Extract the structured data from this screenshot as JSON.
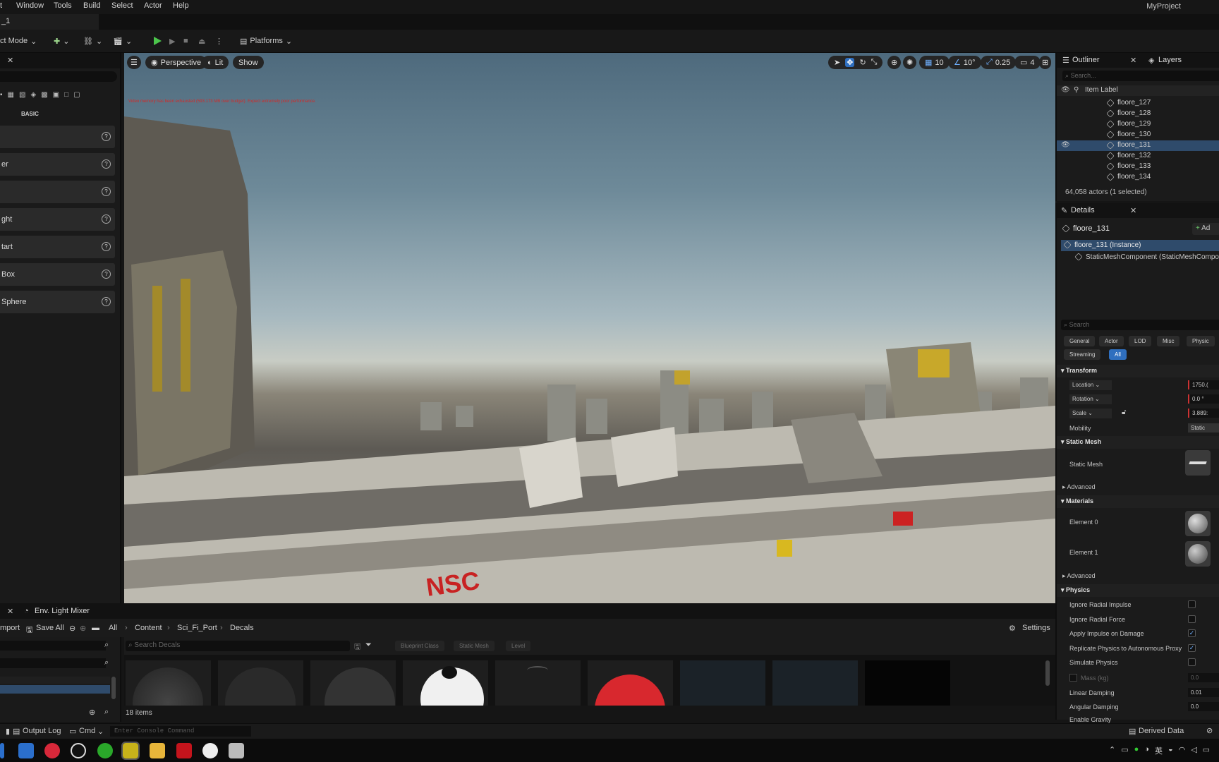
{
  "menu": [
    "Window",
    "Tools",
    "Build",
    "Select",
    "Actor",
    "Help"
  ],
  "project_name": "MyProject",
  "map_tab": "_1",
  "toolbar": {
    "mode": "ct Mode",
    "platforms": "Platforms"
  },
  "place_actors": {
    "category": "BASIC",
    "items": [
      "",
      "er",
      "",
      "ght",
      "tart",
      "Box",
      "Sphere"
    ]
  },
  "viewport": {
    "perspective": "Perspective",
    "lit": "Lit",
    "show": "Show",
    "warning": "Video memory has been exhausted (593.173 MB over budget). Expect extremely poor performance.",
    "grid_snap": "10",
    "rot_snap": "10°",
    "scale_snap": "0.25",
    "cam_speed": "4"
  },
  "outliner": {
    "tab": "Outliner",
    "layers_tab": "Layers",
    "search_placeholder": "Search...",
    "column": "Item Label",
    "items": [
      "floore_127",
      "floore_128",
      "floore_129",
      "floore_130",
      "floore_131",
      "floore_132",
      "floore_133",
      "floore_134"
    ],
    "selected_index": 4,
    "status": "64,058 actors (1 selected)"
  },
  "details": {
    "tab": "Details",
    "actor_name": "floore_131",
    "add_label": "Ad",
    "instance": "floore_131 (Instance)",
    "component": "StaticMeshComponent (StaticMeshCompo",
    "search_placeholder": "Search",
    "filters": [
      "General",
      "Actor",
      "LOD",
      "Misc",
      "Physic",
      "Streaming",
      "All"
    ],
    "transform_title": "Transform",
    "location_label": "Location",
    "location_value": "1750.(",
    "rotation_label": "Rotation",
    "rotation_value": "0.0 °",
    "scale_label": "Scale",
    "scale_value": "3.889:",
    "mobility_label": "Mobility",
    "mobility_value": "Static",
    "static_mesh_title": "Static Mesh",
    "static_mesh_label": "Static Mesh",
    "advanced": "Advanced",
    "materials_title": "Materials",
    "element0": "Element 0",
    "element1": "Element 1",
    "physics_title": "Physics",
    "physics_rows": [
      {
        "label": "Ignore Radial Impulse",
        "checked": false
      },
      {
        "label": "Ignore Radial Force",
        "checked": false
      },
      {
        "label": "Apply Impulse on Damage",
        "checked": true
      },
      {
        "label": "Replicate Physics to Autonomous Proxy",
        "checked": true
      },
      {
        "label": "Simulate Physics",
        "checked": false
      }
    ],
    "mass_label": "Mass (kg)",
    "mass_value": "0.0",
    "linear_damping_label": "Linear Damping",
    "linear_damping_value": "0.01",
    "angular_damping_label": "Angular Damping",
    "angular_damping_value": "0.0",
    "enable_gravity_label": "Enable Gravity",
    "check_mark": "✓"
  },
  "bottom_tabs": {
    "env_light_mixer": "Env. Light Mixer"
  },
  "content_browser": {
    "import": "mport",
    "save_all": "Save All",
    "breadcrumb": [
      "All",
      "Content",
      "Sci_Fi_Port",
      "Decals"
    ],
    "settings": "Settings",
    "search_placeholder": "Search Decals",
    "filter_chips": [
      "Blueprint Class",
      "Static Mesh",
      "Level"
    ],
    "item_count": "18 items"
  },
  "status": {
    "output_log": "Output Log",
    "cmd": "Cmd",
    "console_placeholder": "Enter Console Command",
    "derived_data": "Derived Data"
  },
  "taskbar": {
    "ime": "英"
  },
  "colors": {
    "accent": "#2f6fbf",
    "play": "#4bc54b",
    "warning": "#d12a2a",
    "selected_row": "#2f4b6b"
  }
}
